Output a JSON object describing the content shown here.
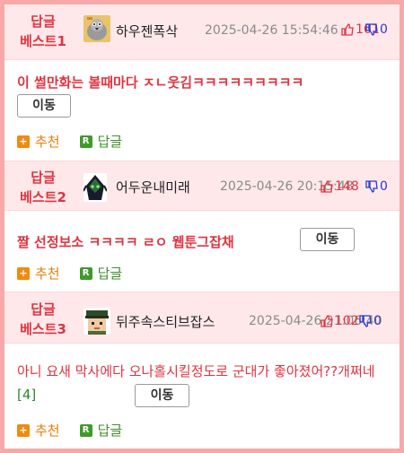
{
  "colors": {
    "border": "#f6a9a9",
    "header_bg": "#ffe8ea",
    "accent_red": "#e0343f",
    "down_blue": "#2a3bc7",
    "recommend_orange": "#f08a10",
    "reply_green": "#3f9a2b"
  },
  "entries": [
    {
      "rank_line1": "답글",
      "rank_line2": "베스트1",
      "avatar_icon": "pigeon-avatar-icon",
      "nickname": "하우젠폭삭",
      "date": "2025-04-26 15:54:46",
      "up_count": "161",
      "down_count": "0",
      "title": "이 썰만화는 볼때마다 ㅈㄴ웃김ㅋㅋㅋㅋㅋㅋㅋㅋㅋ",
      "move_label": "이동",
      "recommend_label": "추천",
      "reply_label": "답글"
    },
    {
      "rank_line1": "답글",
      "rank_line2": "베스트2",
      "avatar_icon": "dark-hooded-avatar-icon",
      "nickname": "어두운내미래",
      "date": "2025-04-26 20:15:48",
      "up_count": "148",
      "down_count": "0",
      "title": "짤 선정보소 ㅋㅋㅋㅋ ㄹㅇ 웹툰그잡채",
      "move_label": "이동",
      "recommend_label": "추천",
      "reply_label": "답글"
    },
    {
      "rank_line1": "답글",
      "rank_line2": "베스트3",
      "avatar_icon": "pixel-soldier-avatar-icon",
      "nickname": "뒤주속스티브잡스",
      "date": "2025-04-26 21:06:40",
      "up_count": "102",
      "down_count": "0",
      "title": "아니 요새 막사에다 오나홀시킬정도로 군대가 좋아졌어??개쩌네",
      "reply_count": "[4]",
      "move_label": "이동",
      "recommend_label": "추천",
      "reply_label": "답글"
    }
  ]
}
